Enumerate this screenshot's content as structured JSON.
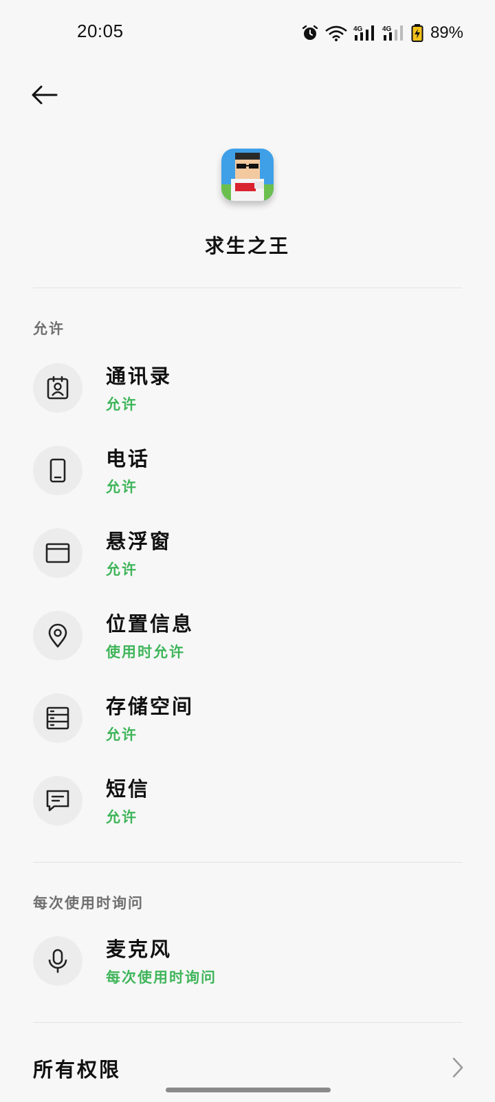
{
  "status_bar": {
    "time": "20:05",
    "battery_percent": "89%",
    "icons": [
      "alarm-icon",
      "wifi-icon",
      "signal-4g-icon",
      "signal-4g-icon",
      "battery-charging-icon"
    ]
  },
  "header": {
    "back_icon": "arrow-left-icon"
  },
  "app": {
    "name": "求生之王"
  },
  "sections": [
    {
      "title": "允许",
      "items": [
        {
          "label": "通讯录",
          "status": "允许",
          "icon": "contacts-icon"
        },
        {
          "label": "电话",
          "status": "允许",
          "icon": "phone-icon"
        },
        {
          "label": "悬浮窗",
          "status": "允许",
          "icon": "floating-window-icon"
        },
        {
          "label": "位置信息",
          "status": "使用时允许",
          "icon": "location-icon"
        },
        {
          "label": "存储空间",
          "status": "允许",
          "icon": "storage-icon"
        },
        {
          "label": "短信",
          "status": "允许",
          "icon": "sms-icon"
        }
      ]
    },
    {
      "title": "每次使用时询问",
      "items": [
        {
          "label": "麦克风",
          "status": "每次使用时询问",
          "icon": "microphone-icon"
        }
      ]
    }
  ],
  "footer": {
    "all_permissions_label": "所有权限"
  },
  "colors": {
    "accent_green": "#3fb55a",
    "background": "#f7f7f7",
    "icon_circle": "#ececec"
  }
}
